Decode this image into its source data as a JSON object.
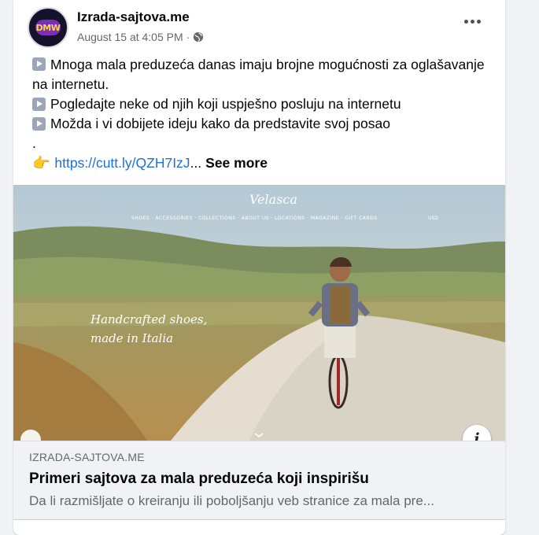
{
  "post": {
    "page_name": "Izrada-sajtova.me",
    "timestamp": "August 15 at 4:05 PM",
    "separator": "·",
    "avatar_text": "DMW",
    "privacy_icon": "globe-icon",
    "more_icon": "more-options-icon",
    "lines": [
      "Mnoga mala preduzeća danas imaju brojne mogućnosti za oglašavanje na internetu.",
      "Pogledajte neke od njih koji uspješno posluju na internetu",
      "Možda i vi dobijete ideju kako da predstavite svoj posao"
    ],
    "dot_line": ".",
    "link_text": "https://cutt.ly/QZH7IzJ",
    "ellipsis": "...",
    "see_more": "See more"
  },
  "image": {
    "brand": "Velasca",
    "nav": "SHOES · ACCESSORIES · COLLECTIONS · ABOUT US · LOCATIONS · MAGAZINE · GIFT CARDS",
    "nav_right": "USD",
    "tagline_1": "Handcrafted shoes,",
    "tagline_2": "made in Italia",
    "info_label": "i"
  },
  "preview": {
    "domain": "IZRADA-SAJTOVA.ME",
    "title": "Primeri sajtova za mala preduzeća koji inspirišu",
    "description": "Da li razmišljate o kreiranju ili poboljšanju veb stranice za mala pre..."
  }
}
